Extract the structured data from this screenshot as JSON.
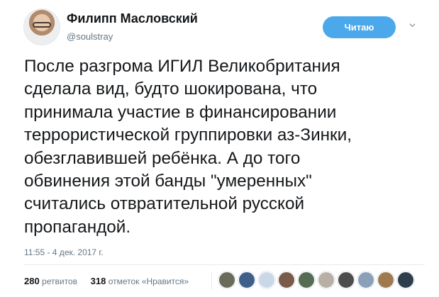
{
  "author": {
    "name": "Филипп Масловский",
    "handle": "@soulstray"
  },
  "follow_button": {
    "label": "Читаю"
  },
  "icons": {
    "avatar": "portrait-avatar",
    "menu": "chevron-down-icon"
  },
  "tweet": {
    "text": "После разгрома ИГИЛ Великобритания\nсделала вид, будто шокирована, что\nпринимала участие в финансировании\nтеррористической группировки аз-Зинки,\nобезглавившей ребёнка. А до того\nобвинения этой банды \"умеренных\"\nсчитались отвратительной русской\nпропагандой.",
    "timestamp": "11:55 - 4 дек. 2017 г."
  },
  "stats": {
    "retweets_count": "280",
    "retweets_label": "ретвитов",
    "likes_count": "318",
    "likes_label": "отметок «Нравится»"
  },
  "liker_avatars": [
    {
      "color": "#6b6b5a"
    },
    {
      "color": "#3d5f8a"
    },
    {
      "color": "#c9d7e6"
    },
    {
      "color": "#7a5a48"
    },
    {
      "color": "#556b52"
    },
    {
      "color": "#b8b0a5"
    },
    {
      "color": "#4d4d4d"
    },
    {
      "color": "#8aa0b8"
    },
    {
      "color": "#a07a4f"
    },
    {
      "color": "#2f3e4d"
    }
  ],
  "colors": {
    "accent": "#4ba9eb",
    "text": "#14171a",
    "secondary": "#657786"
  }
}
